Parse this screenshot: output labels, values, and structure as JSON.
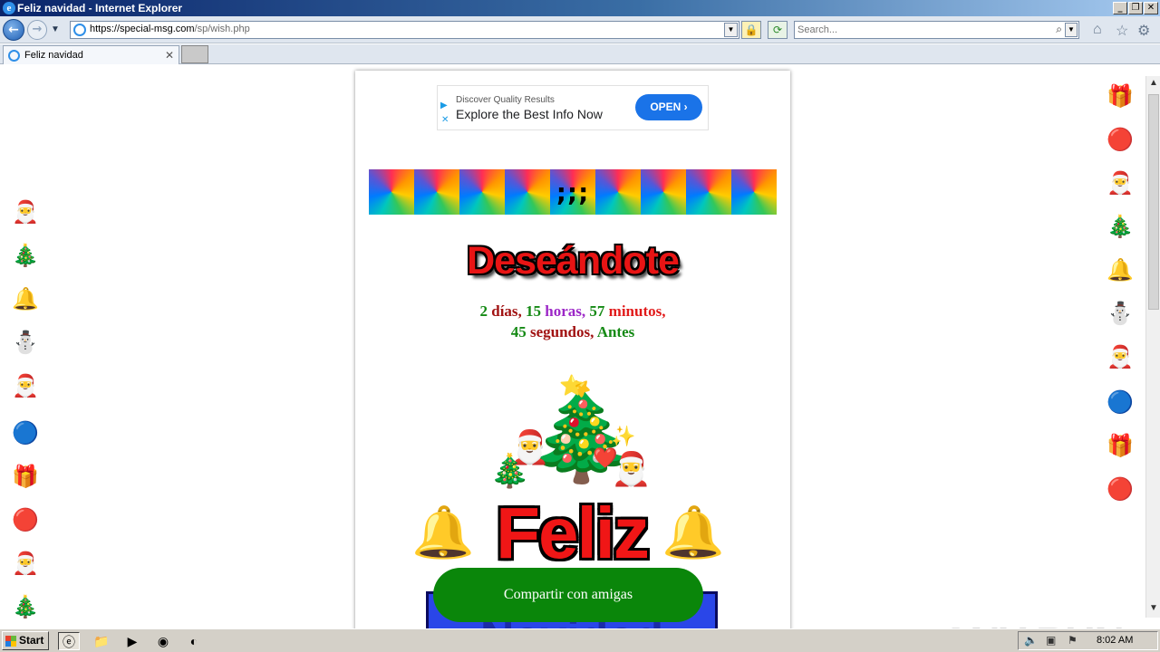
{
  "window": {
    "title": "Feliz navidad - Internet Explorer"
  },
  "address_bar": {
    "url_host": "https://special-msg.com",
    "url_path": "/sp/wish.php"
  },
  "search": {
    "placeholder": "Search..."
  },
  "tabs": [
    {
      "label": "Feliz navidad"
    }
  ],
  "ad": {
    "top_text": "Discover Quality Results",
    "main_text": "Explore the Best Info Now",
    "button_label": "OPEN"
  },
  "card": {
    "strip_symbol": ";;;",
    "heading": "Deseándote",
    "countdown": {
      "days_num": "2",
      "days_label": "días,",
      "hours_num": "15",
      "hours_label": "horas,",
      "minutes_num": "57",
      "minutes_label": "minutos,",
      "seconds_num": "45",
      "seconds_label": "segundos,",
      "suffix": "Antes"
    },
    "feliz": "Feliz",
    "navidad": "Navidad",
    "share_button": "Compartir con amigas"
  },
  "left_icons": [
    "santa-icon",
    "tree-icon",
    "bell-icon",
    "snowman-icon",
    "santa-hat-icon",
    "ornament-blue-icon",
    "gift-icon",
    "ornament-red-icon",
    "santa-icon",
    "tree-icon"
  ],
  "right_icons": [
    "gift-icon",
    "ornament-red-icon",
    "santa-icon",
    "tree-icon",
    "bell-icon",
    "snowman-icon",
    "santa-hat-icon",
    "ornament-blue-icon",
    "gift-icon",
    "ornament-red-icon"
  ],
  "taskbar": {
    "start_label": "Start",
    "clock": "8:02 AM"
  },
  "watermark": "ANY RUN"
}
